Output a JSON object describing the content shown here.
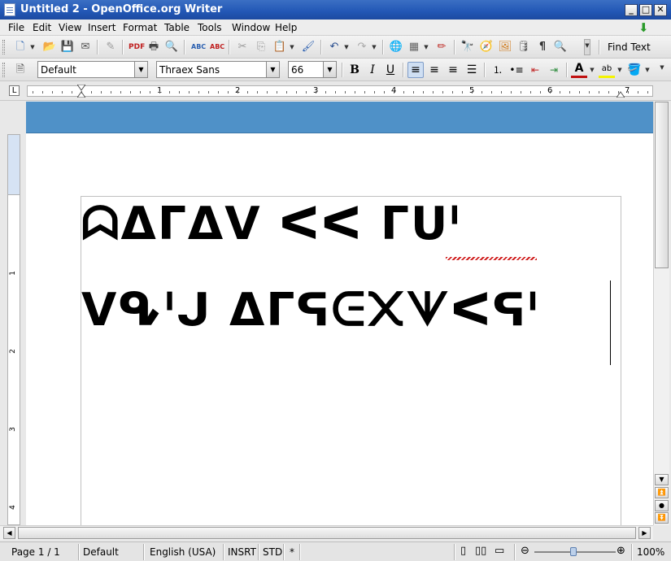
{
  "window": {
    "title": "Untitled 2 - OpenOffice.org Writer"
  },
  "menu": [
    "File",
    "Edit",
    "View",
    "Insert",
    "Format",
    "Table",
    "Tools",
    "Window",
    "Help"
  ],
  "toolbar": {
    "find_text_label": "Find Text"
  },
  "formatting": {
    "paragraph_style": "Default",
    "font_name": "Thraex Sans",
    "font_size": "66",
    "bold": "B",
    "italic": "I",
    "underline": "U"
  },
  "ruler": {
    "numbers": [
      "1",
      "2",
      "3",
      "4",
      "5",
      "6",
      "7"
    ],
    "vnumbers": [
      "1",
      "2",
      "3",
      "4"
    ]
  },
  "document": {
    "line1": "ᗣᐃᒥᐃᐯ ᐸᐸ ᒥᑌᑊ",
    "line2": "ᐯᕴᑊᒍ ᐃᒥᕋᕮ᙭ᗐᐸᕋᑊ"
  },
  "status": {
    "page": "Page 1 / 1",
    "style": "Default",
    "language": "English (USA)",
    "insert_mode": "INSRT",
    "selection_mode": "STD",
    "modified": "*",
    "zoom": "100%"
  },
  "colors": {
    "accent_band": "#4f91c8",
    "titlebar": "#2257b5"
  }
}
